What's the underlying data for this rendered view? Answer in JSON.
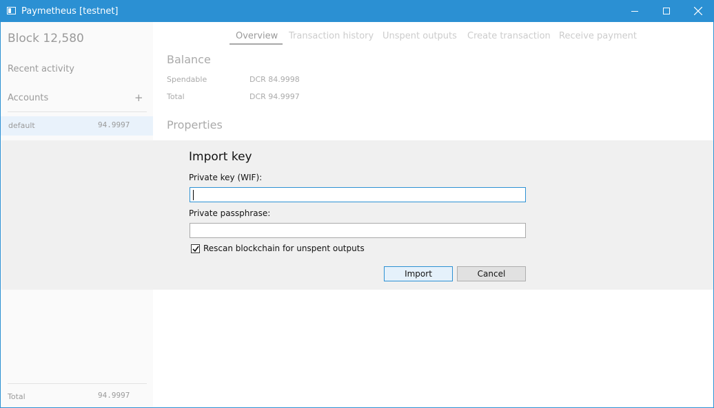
{
  "window": {
    "title": "Paymetheus [testnet]"
  },
  "sidebar": {
    "block_height": "Block 12,580",
    "recent_activity": "Recent activity",
    "accounts_heading": "Accounts",
    "add_account_symbol": "+",
    "accounts": [
      {
        "name": "default",
        "balance": "94.9997"
      }
    ],
    "total_label": "Total",
    "total_value": "94.9997"
  },
  "tabs": [
    {
      "label": "Overview",
      "active": true
    },
    {
      "label": "Transaction history",
      "active": false
    },
    {
      "label": "Unspent outputs",
      "active": false
    },
    {
      "label": "Create transaction",
      "active": false
    },
    {
      "label": "Receive payment",
      "active": false
    }
  ],
  "overview": {
    "balance_heading": "Balance",
    "spendable_label": "Spendable",
    "spendable_value": "DCR 84.9998",
    "total_label": "Total",
    "total_value": "DCR 94.9997",
    "properties_heading": "Properties"
  },
  "import_dialog": {
    "title": "Import key",
    "private_key_label": "Private key (WIF):",
    "private_key_value": "",
    "passphrase_label": "Private passphrase:",
    "passphrase_value": "",
    "rescan_label": "Rescan blockchain for unspent outputs",
    "rescan_checked": true,
    "import_label": "Import",
    "cancel_label": "Cancel"
  },
  "colors": {
    "titlebar": "#2b90d3",
    "selected_account": "#e9f2fb",
    "dialog_background": "#f0f0f0"
  }
}
